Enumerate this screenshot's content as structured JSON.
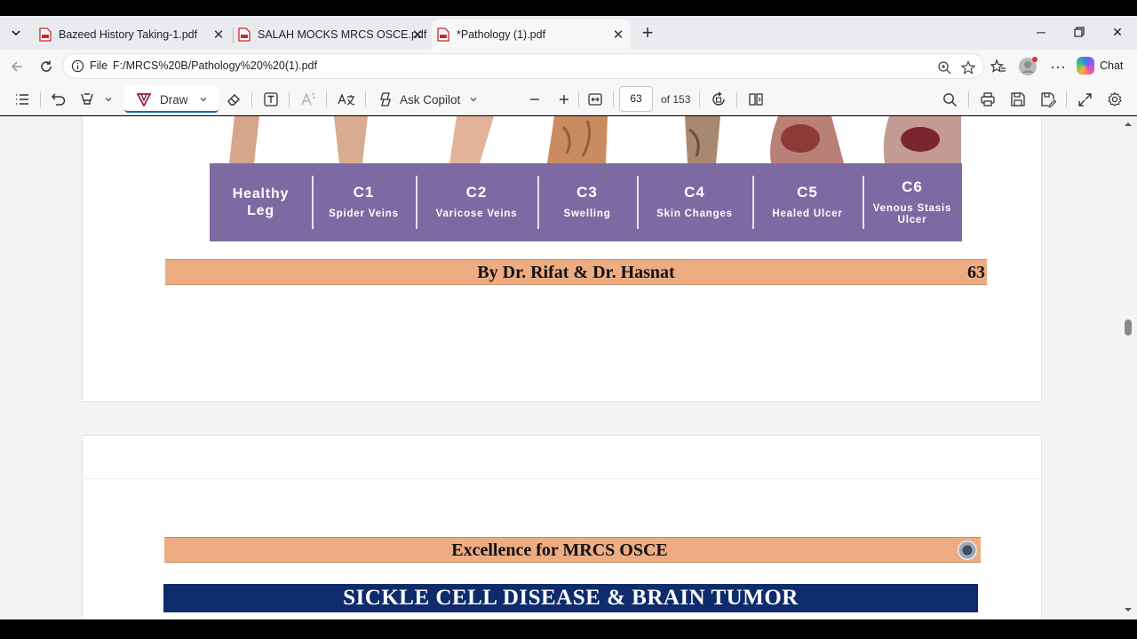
{
  "tabs": [
    {
      "label": "Bazeed History Taking-1.pdf",
      "active": false
    },
    {
      "label": "SALAH MOCKS MRCS OSCE.pdf",
      "active": false
    },
    {
      "label": "*Pathology (1).pdf",
      "active": true
    }
  ],
  "address": {
    "scheme_label": "File",
    "url": "F:/MRCS%20B/Pathology%20%20(1).pdf"
  },
  "chat_label": "Chat",
  "pdf_toolbar": {
    "draw_label": "Draw",
    "ask_copilot_label": "Ask Copilot",
    "page_number": "63",
    "page_total": "of 153"
  },
  "page_63": {
    "ceap": [
      {
        "code": "",
        "desc": "Healthy Leg"
      },
      {
        "code": "C1",
        "desc": "Spider Veins"
      },
      {
        "code": "C2",
        "desc": "Varicose Veins"
      },
      {
        "code": "C3",
        "desc": "Swelling"
      },
      {
        "code": "C4",
        "desc": "Skin Changes"
      },
      {
        "code": "C5",
        "desc": "Healed Ulcer"
      },
      {
        "code": "C6",
        "desc": "Venous Stasis Ulcer"
      }
    ],
    "footer_authors": "By Dr. Rifat & Dr. Hasnat",
    "footer_page": "63"
  },
  "page_64": {
    "header_text": "Excellence for MRCS OSCE",
    "title": "SICKLE CELL DISEASE & BRAIN TUMOR"
  },
  "colors": {
    "ceap_band": "#7d6aa3",
    "peach_band": "#edac82",
    "title_band": "#0e2b6b"
  }
}
